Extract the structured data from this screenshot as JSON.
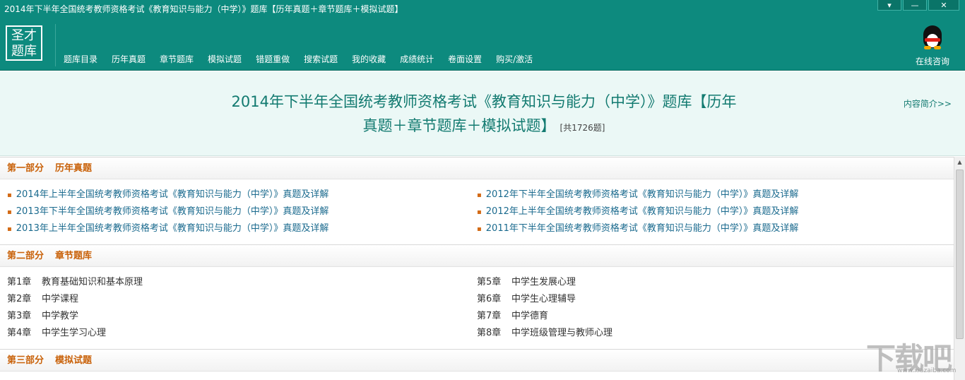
{
  "window": {
    "title": "2014年下半年全国统考教师资格考试《教育知识与能力（中学）》题库【历年真题＋章节题库＋模拟试题】",
    "buttons": {
      "menu": "▾",
      "minimize": "—",
      "close": "✕"
    }
  },
  "logo": {
    "line1": "圣才",
    "line2": "题库"
  },
  "nav": [
    "题库目录",
    "历年真题",
    "章节题库",
    "模拟试题",
    "错题重做",
    "搜索试题",
    "我的收藏",
    "成绩统计",
    "卷面设置",
    "购买/激活"
  ],
  "consult": {
    "label": "在线咨询",
    "icon": "qq-penguin-icon"
  },
  "header": {
    "title_line1": "2014年下半年全国统考教师资格考试《教育知识与能力（中学）》题库【历年",
    "title_line2": "真题＋章节题库＋模拟试题】",
    "count": "[共1726题]",
    "intro_link": "内容简介>>"
  },
  "sections": {
    "part1": {
      "label": "第一部分",
      "name": "历年真题",
      "left": [
        "2014年上半年全国统考教师资格考试《教育知识与能力（中学）》真题及详解",
        "2013年下半年全国统考教师资格考试《教育知识与能力（中学）》真题及详解",
        "2013年上半年全国统考教师资格考试《教育知识与能力（中学）》真题及详解"
      ],
      "right": [
        "2012年下半年全国统考教师资格考试《教育知识与能力（中学）》真题及详解",
        "2012年上半年全国统考教师资格考试《教育知识与能力（中学）》真题及详解",
        "2011年下半年全国统考教师资格考试《教育知识与能力（中学）》真题及详解"
      ]
    },
    "part2": {
      "label": "第二部分",
      "name": "章节题库",
      "left": [
        {
          "no": "第1章",
          "name": "教育基础知识和基本原理"
        },
        {
          "no": "第2章",
          "name": "中学课程"
        },
        {
          "no": "第3章",
          "name": "中学教学"
        },
        {
          "no": "第4章",
          "name": "中学生学习心理"
        }
      ],
      "right": [
        {
          "no": "第5章",
          "name": "中学生发展心理"
        },
        {
          "no": "第6章",
          "name": "中学生心理辅导"
        },
        {
          "no": "第7章",
          "name": "中学德育"
        },
        {
          "no": "第8章",
          "name": "中学班级管理与教师心理"
        }
      ]
    },
    "part3": {
      "label": "第三部分",
      "name": "模拟试题"
    }
  },
  "watermark": {
    "main": "下载吧",
    "sub": "www.xiazaiba.com"
  }
}
